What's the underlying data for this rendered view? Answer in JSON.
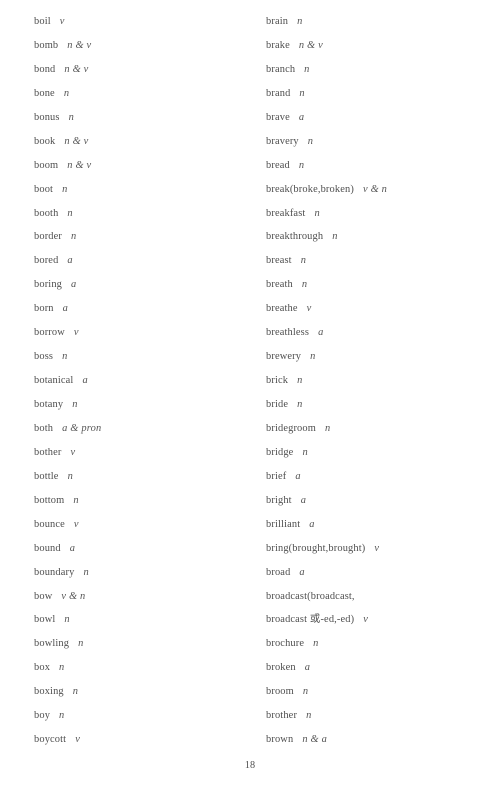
{
  "page": {
    "number": "18",
    "background_color": "#ffffff",
    "text_color": "#4a4a4a"
  },
  "columns": {
    "left": [
      {
        "word": "boil",
        "pos": "v"
      },
      {
        "word": "bomb",
        "pos": "n & v"
      },
      {
        "word": "bond",
        "pos": "n & v"
      },
      {
        "word": "bone",
        "pos": "n"
      },
      {
        "word": "bonus",
        "pos": "n"
      },
      {
        "word": "book",
        "pos": "n & v"
      },
      {
        "word": "boom",
        "pos": "n & v"
      },
      {
        "word": "boot",
        "pos": "n"
      },
      {
        "word": "booth",
        "pos": "n"
      },
      {
        "word": "border",
        "pos": "n"
      },
      {
        "word": "bored",
        "pos": "a"
      },
      {
        "word": "boring",
        "pos": "a"
      },
      {
        "word": "born",
        "pos": "a"
      },
      {
        "word": "borrow",
        "pos": "v"
      },
      {
        "word": "boss",
        "pos": "n"
      },
      {
        "word": "botanical",
        "pos": "a"
      },
      {
        "word": "botany",
        "pos": "n"
      },
      {
        "word": "both",
        "pos": "a & pron"
      },
      {
        "word": "bother",
        "pos": "v"
      },
      {
        "word": "bottle",
        "pos": "n"
      },
      {
        "word": "bottom",
        "pos": "n"
      },
      {
        "word": "bounce",
        "pos": "v"
      },
      {
        "word": "bound",
        "pos": "a"
      },
      {
        "word": "boundary",
        "pos": "n"
      },
      {
        "word": "bow",
        "pos": "v & n"
      },
      {
        "word": "bowl",
        "pos": "n"
      },
      {
        "word": "bowling",
        "pos": "n"
      },
      {
        "word": "box",
        "pos": "n"
      },
      {
        "word": "boxing",
        "pos": "n"
      },
      {
        "word": "boy",
        "pos": "n"
      },
      {
        "word": "boycott",
        "pos": "v"
      }
    ],
    "right": [
      {
        "word": "brain",
        "pos": "n"
      },
      {
        "word": "brake",
        "pos": "n & v"
      },
      {
        "word": "branch",
        "pos": "n"
      },
      {
        "word": "brand",
        "pos": "n"
      },
      {
        "word": "brave",
        "pos": "a"
      },
      {
        "word": "bravery",
        "pos": "n"
      },
      {
        "word": "bread",
        "pos": "n"
      },
      {
        "word": "break(broke,broken)",
        "pos": "v & n"
      },
      {
        "word": "breakfast",
        "pos": "n"
      },
      {
        "word": "breakthrough",
        "pos": "n"
      },
      {
        "word": "breast",
        "pos": "n"
      },
      {
        "word": "breath",
        "pos": "n"
      },
      {
        "word": "breathe",
        "pos": "v"
      },
      {
        "word": "breathless",
        "pos": "a"
      },
      {
        "word": "brewery",
        "pos": "n"
      },
      {
        "word": "brick",
        "pos": "n"
      },
      {
        "word": "bride",
        "pos": "n"
      },
      {
        "word": "bridegroom",
        "pos": "n"
      },
      {
        "word": "bridge",
        "pos": "n"
      },
      {
        "word": "brief",
        "pos": "a"
      },
      {
        "word": "bright",
        "pos": "a"
      },
      {
        "word": "brilliant",
        "pos": "a"
      },
      {
        "word": "bring(brought,brought)",
        "pos": "v"
      },
      {
        "word": "broad",
        "pos": "a"
      },
      {
        "word": "broadcast(broadcast,",
        "pos": "",
        "continued": true
      },
      {
        "word": "broadcast 或-ed,-ed)",
        "pos": "v"
      },
      {
        "word": "brochure",
        "pos": "n"
      },
      {
        "word": "broken",
        "pos": "a"
      },
      {
        "word": "broom",
        "pos": "n"
      },
      {
        "word": "brother",
        "pos": "n"
      },
      {
        "word": "brown",
        "pos": "n & a"
      }
    ]
  }
}
